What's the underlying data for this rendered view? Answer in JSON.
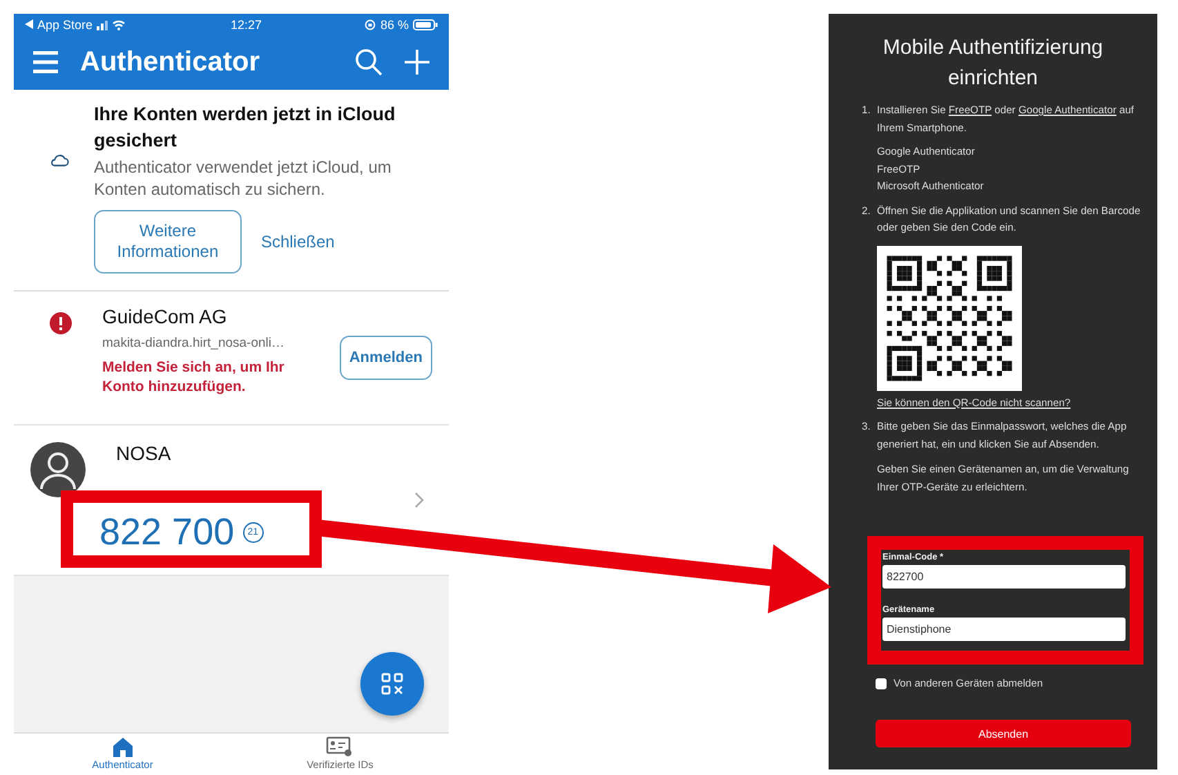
{
  "phone": {
    "status_bar": {
      "carrier": "App Store",
      "time": "12:27",
      "battery": "86 %"
    },
    "header": {
      "title": "Authenticator"
    },
    "banner": {
      "title": "Ihre Konten werden jetzt in iCloud gesichert",
      "text": "Authenticator verwendet jetzt iCloud, um Konten automatisch zu sichern.",
      "buttons": [
        {
          "label": "Weitere Informationen",
          "kind": "outlined"
        },
        {
          "label": "Schließen",
          "kind": "text"
        }
      ]
    },
    "accounts": [
      {
        "kind": "warning",
        "name": "GuideCom AG",
        "username": "makita-diandra.hirt_nosa-onli…",
        "message": "Melden Sie sich an, um Ihr Konto hinzuzufügen.",
        "action": "Anmelden"
      },
      {
        "kind": "code",
        "name": "NOSA",
        "code": "822 700",
        "countdown": "21"
      }
    ],
    "tabs": [
      {
        "label": "Authenticator",
        "selected": true,
        "kind": "home"
      },
      {
        "label": "Verifizierte IDs",
        "selected": false,
        "kind": "id"
      }
    ]
  },
  "setup": {
    "title": "Mobile Authentifizierung einrichten",
    "steps": [
      {
        "number": "1.",
        "parts": [
          {
            "text": "Installieren Sie "
          },
          {
            "text": "FreeOTP",
            "link": true
          },
          {
            "text": " oder "
          },
          {
            "text": "Google Authenticator",
            "link": true
          },
          {
            "text": " auf Ihrem Smartphone."
          }
        ],
        "apps": [
          "Google Authenticator",
          "FreeOTP",
          "Microsoft Authenticator"
        ]
      },
      {
        "number": "2.",
        "parts": [
          {
            "text": "Öffnen Sie die Applikation und scannen Sie den Barcode oder geben Sie den Code ein."
          }
        ],
        "qr_link": "Sie können den QR-Code nicht scannen?"
      },
      {
        "number": "3.",
        "parts": [
          {
            "text": "Bitte geben Sie das Einmalpasswort, welches die App generiert hat, ein und klicken Sie auf Absenden."
          }
        ],
        "note": "Geben Sie einen Gerätenamen an, um die Verwaltung Ihrer OTP-Geräte zu erleichtern."
      }
    ],
    "fields": [
      {
        "label": "Einmal-Code *",
        "value": "822700"
      },
      {
        "label": "Gerätename",
        "value": "Dienstiphone"
      }
    ],
    "checkbox": {
      "label": "Von anderen Geräten abmelden",
      "checked": false
    },
    "submit": "Absenden"
  }
}
